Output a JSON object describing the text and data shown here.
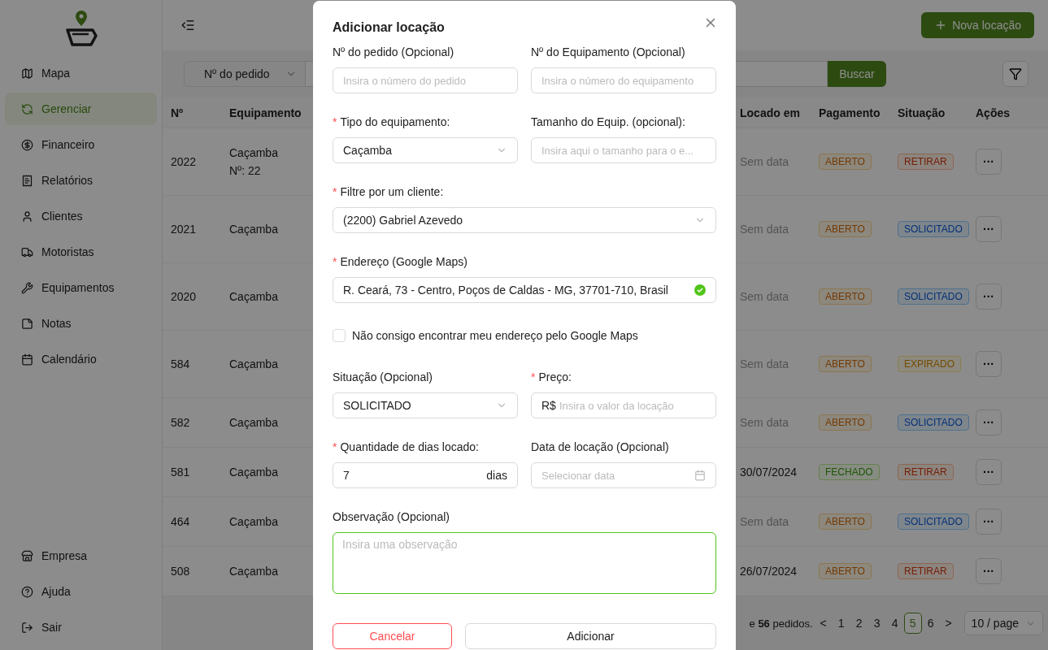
{
  "sidebar": {
    "items": [
      {
        "label": "Mapa",
        "selected": false
      },
      {
        "label": "Gerenciar",
        "selected": true
      },
      {
        "label": "Financeiro",
        "selected": false
      },
      {
        "label": "Relatórios",
        "selected": false
      },
      {
        "label": "Clientes",
        "selected": false
      },
      {
        "label": "Motoristas",
        "selected": false
      },
      {
        "label": "Equipamentos",
        "selected": false
      },
      {
        "label": "Notas",
        "selected": false
      },
      {
        "label": "Calendário",
        "selected": false
      }
    ],
    "bottom_items": [
      {
        "label": "Empresa"
      },
      {
        "label": "Ajuda"
      },
      {
        "label": "Sair"
      }
    ]
  },
  "header": {
    "new_button": "Nova locação"
  },
  "toolbar": {
    "search_by": "Nº do pedido",
    "search_button": "Buscar"
  },
  "table": {
    "columns": [
      "Nº",
      "Equipamento",
      "Locado em",
      "Pagamento",
      "Situação",
      "Ações"
    ],
    "rows": [
      {
        "no": "2022",
        "equipment": "Caçamba",
        "equipment_no": "Nº: 22",
        "rented_on": "Sem data",
        "dated": false,
        "payment": {
          "label": "ABERTO",
          "kind": "orange"
        },
        "status": {
          "label": "RETIRAR",
          "kind": "volcano"
        },
        "actions": "···"
      },
      {
        "no": "2021",
        "equipment": "Caçamba",
        "rented_on": "Sem data",
        "dated": false,
        "payment": {
          "label": "ABERTO",
          "kind": "orange"
        },
        "status": {
          "label": "SOLICITADO",
          "kind": "blue"
        },
        "actions": "···"
      },
      {
        "no": "2020",
        "equipment": "Caçamba",
        "rented_on": "Sem data",
        "dated": false,
        "payment": {
          "label": "ABERTO",
          "kind": "orange"
        },
        "status": {
          "label": "SOLICITADO",
          "kind": "blue"
        },
        "actions": "···"
      },
      {
        "no": "584",
        "equipment": "Caçamba",
        "rented_on": "Sem data",
        "dated": false,
        "payment": {
          "label": "ABERTO",
          "kind": "orange"
        },
        "status": {
          "label": "EXPIRADO",
          "kind": "gold"
        },
        "actions": "···"
      },
      {
        "no": "582",
        "equipment": "Caçamba",
        "rented_on": "Sem data",
        "dated": false,
        "payment": {
          "label": "ABERTO",
          "kind": "orange"
        },
        "status": {
          "label": "SOLICITADO",
          "kind": "blue"
        },
        "actions": "···"
      },
      {
        "no": "581",
        "equipment": "Caçamba",
        "rented_on": "30/07/2024",
        "dated": true,
        "payment": {
          "label": "FECHADO",
          "kind": "green"
        },
        "status": {
          "label": "RETIRAR",
          "kind": "volcano"
        },
        "actions": "···"
      },
      {
        "no": "464",
        "equipment": "Caçamba",
        "rented_on": "Sem data",
        "dated": false,
        "payment": {
          "label": "ABERTO",
          "kind": "orange"
        },
        "status": {
          "label": "SOLICITADO",
          "kind": "blue"
        },
        "actions": "···"
      },
      {
        "no": "508",
        "equipment": "Caçamba",
        "rented_on": "26/07/2024",
        "dated": true,
        "payment": {
          "label": "ABERTO",
          "kind": "orange"
        },
        "status": {
          "label": "RETIRAR",
          "kind": "volcano"
        },
        "actions": "···"
      }
    ]
  },
  "pagination": {
    "summary": "e **56** pedidos.",
    "prev": "<",
    "pages": [
      {
        "label": "1",
        "selected": false
      },
      {
        "label": "2",
        "selected": false
      },
      {
        "label": "3",
        "selected": false
      },
      {
        "label": "4",
        "selected": false
      },
      {
        "label": "5",
        "selected": true
      },
      {
        "label": "6",
        "selected": false
      }
    ],
    "next": ">",
    "page_size": "10 / page"
  },
  "modal": {
    "title": "Adicionar locação",
    "fields": [
      {
        "kind": "input",
        "label": "Nº do pedido (Opcional)",
        "placeholder": "Insira o número do pedido"
      },
      {
        "kind": "input",
        "label": "Nº do Equipamento (Opcional)",
        "placeholder": "Insira o número do equipamento"
      },
      {
        "kind": "select",
        "label": "Tipo do equipamento:",
        "required_mark": "*",
        "value": "Caçamba"
      },
      {
        "kind": "input",
        "label": "Tamanho do Equip. (opcional):",
        "placeholder": "Insira aqui o tamanho para o e..."
      },
      {
        "kind": "select",
        "label": "Filtre por um cliente:",
        "required_mark": "*",
        "value": "(2200) Gabriel Azevedo",
        "wide": true
      },
      {
        "kind": "address",
        "label": "Endereço (Google Maps)",
        "required_mark": "*",
        "value": "R. Ceará, 73 - Centro, Poços de Caldas - MG, 37701-710, Brasil",
        "valid": true,
        "wide": true
      },
      {
        "kind": "checkbox",
        "label": "Não consigo encontrar meu endereço pelo Google Maps",
        "checked": false,
        "wide": true
      },
      {
        "kind": "select",
        "label": "Situação (Opcional)",
        "value": "SOLICITADO"
      },
      {
        "kind": "price",
        "label": "Preço:",
        "required_mark": "*",
        "prefix": "R$",
        "placeholder": "Insira o valor da locação"
      },
      {
        "kind": "number",
        "label": "Quantidade de dias locado:",
        "required_mark": "*",
        "value": "7",
        "suffix": "dias"
      },
      {
        "kind": "date",
        "label": "Data de locação (Opcional)",
        "placeholder": "Selecionar data"
      },
      {
        "kind": "textarea",
        "label": "Observação (Opcional)",
        "placeholder": "Insira uma observação",
        "focused": true,
        "wide": true
      }
    ],
    "buttons": {
      "cancel": "Cancelar",
      "confirm": "Adicionar"
    }
  }
}
